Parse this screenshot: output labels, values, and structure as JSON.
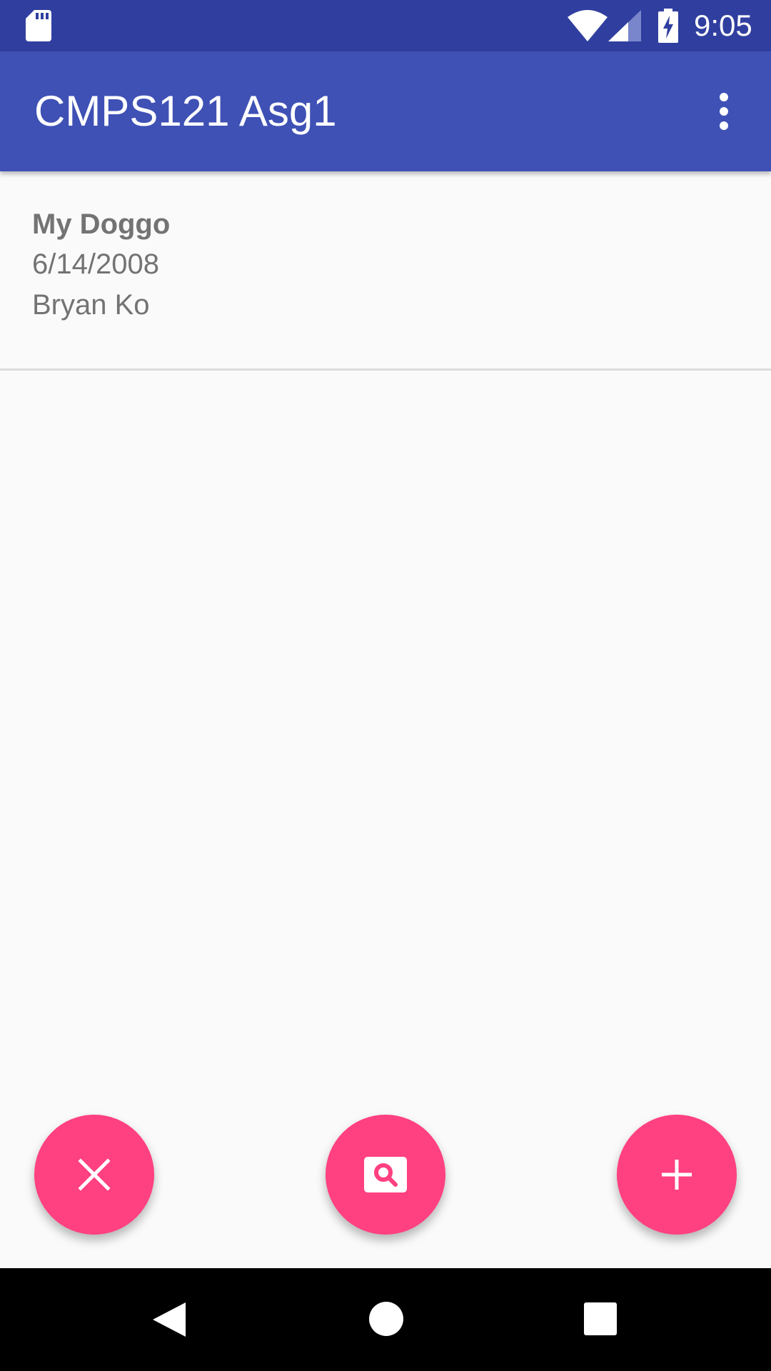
{
  "status_bar": {
    "time": "9:05",
    "icons": [
      "sd-card-icon",
      "wifi-icon",
      "cell-signal-icon",
      "battery-charging-icon"
    ]
  },
  "app_bar": {
    "title": "CMPS121 Asg1",
    "menu_icon": "overflow-menu-icon"
  },
  "list": {
    "items": [
      {
        "title": "My Doggo",
        "date": "6/14/2008",
        "author": "Bryan Ko"
      }
    ]
  },
  "fabs": [
    {
      "icon": "close-icon"
    },
    {
      "icon": "image-search-icon"
    },
    {
      "icon": "add-icon"
    }
  ],
  "nav_bar": {
    "icons": [
      "back-icon",
      "home-icon",
      "recents-icon"
    ]
  },
  "colors": {
    "status_bar": "#303F9F",
    "app_bar": "#3F51B5",
    "accent": "#FF4081",
    "background": "#FAFAFA",
    "text_secondary": "#737373"
  }
}
